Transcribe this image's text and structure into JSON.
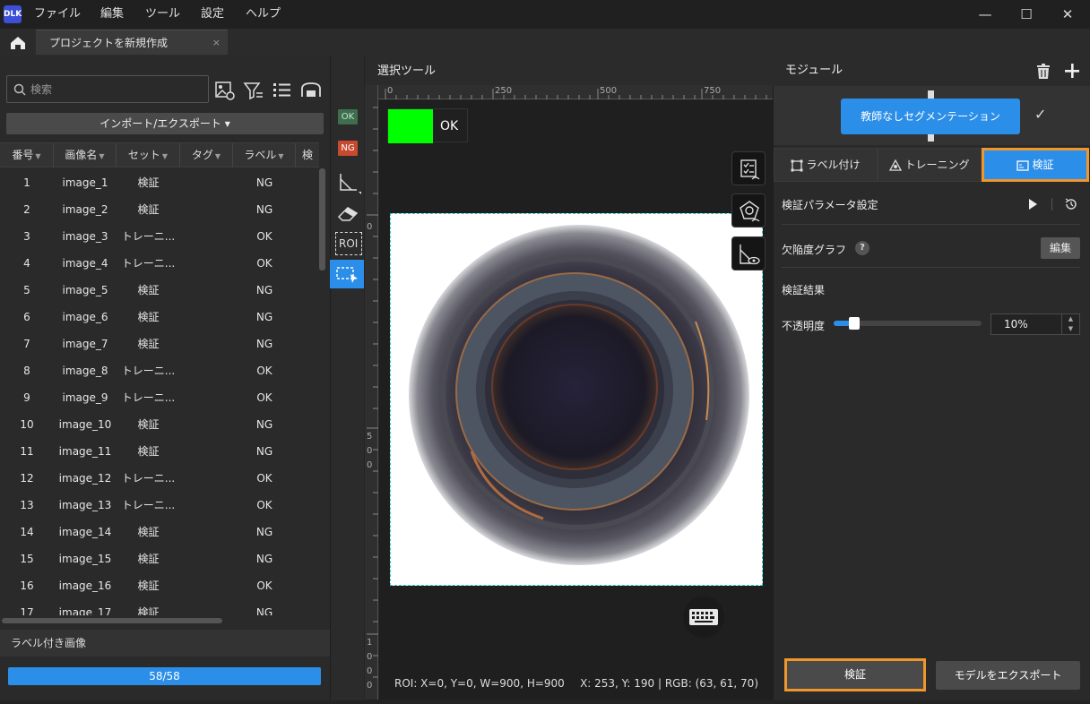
{
  "app": {
    "logo_text": "DLK",
    "menu": [
      "ファイル",
      "編集",
      "ツール",
      "設定",
      "ヘルプ"
    ],
    "window_controls": {
      "minimize": "—",
      "maximize": "☐",
      "close": "✕"
    }
  },
  "tabs": {
    "project_tab": "プロジェクトを新規作成",
    "close_glyph": "×"
  },
  "left": {
    "search_placeholder": "検索",
    "import_export_label": "インポート/エクスポート ▾",
    "table": {
      "headers": [
        "番号",
        "画像名",
        "セット",
        "タグ",
        "ラベル",
        "検"
      ],
      "rows": [
        {
          "no": "1",
          "name": "image_1",
          "set": "検証",
          "tag": "",
          "label": "NG"
        },
        {
          "no": "2",
          "name": "image_2",
          "set": "検証",
          "tag": "",
          "label": "NG"
        },
        {
          "no": "3",
          "name": "image_3",
          "set": "トレーニ...",
          "tag": "",
          "label": "OK"
        },
        {
          "no": "4",
          "name": "image_4",
          "set": "トレーニ...",
          "tag": "",
          "label": "OK"
        },
        {
          "no": "5",
          "name": "image_5",
          "set": "検証",
          "tag": "",
          "label": "NG"
        },
        {
          "no": "6",
          "name": "image_6",
          "set": "検証",
          "tag": "",
          "label": "NG"
        },
        {
          "no": "7",
          "name": "image_7",
          "set": "検証",
          "tag": "",
          "label": "NG"
        },
        {
          "no": "8",
          "name": "image_8",
          "set": "トレーニ...",
          "tag": "",
          "label": "OK"
        },
        {
          "no": "9",
          "name": "image_9",
          "set": "トレーニ...",
          "tag": "",
          "label": "OK"
        },
        {
          "no": "10",
          "name": "image_10",
          "set": "検証",
          "tag": "",
          "label": "NG"
        },
        {
          "no": "11",
          "name": "image_11",
          "set": "検証",
          "tag": "",
          "label": "NG"
        },
        {
          "no": "12",
          "name": "image_12",
          "set": "トレーニ...",
          "tag": "",
          "label": "OK"
        },
        {
          "no": "13",
          "name": "image_13",
          "set": "トレーニ...",
          "tag": "",
          "label": "OK"
        },
        {
          "no": "14",
          "name": "image_14",
          "set": "検証",
          "tag": "",
          "label": "NG"
        },
        {
          "no": "15",
          "name": "image_15",
          "set": "検証",
          "tag": "",
          "label": "NG"
        },
        {
          "no": "16",
          "name": "image_16",
          "set": "検証",
          "tag": "",
          "label": "OK"
        },
        {
          "no": "17",
          "name": "image_17",
          "set": "検証",
          "tag": "",
          "label": "NG"
        }
      ]
    },
    "labeled_images_title": "ラベル付き画像",
    "progress": {
      "text": "58/58",
      "fraction": 1.0
    }
  },
  "toolstrip": {
    "ok_tag": "OK",
    "ng_tag": "NG",
    "roi_label": "ROI"
  },
  "canvas": {
    "title": "選択ツール",
    "ruler_top": [
      "0",
      "250",
      "500",
      "750"
    ],
    "ruler_left": [
      "0",
      "5\n0\n0",
      "1\n0\n0\n0"
    ],
    "result": {
      "text": "OK",
      "color": "#00ff00"
    },
    "roi_status": "ROI: X=0, Y=0, W=900, H=900",
    "cursor_status": "X: 253, Y: 190 | RGB: (63, 61, 70)"
  },
  "right": {
    "module_title": "モジュール",
    "module_node": "教師なしセグメンテーション",
    "module_check": "✓",
    "tabs": [
      {
        "label": "ラベル付け",
        "active": false
      },
      {
        "label": "トレーニング",
        "active": false
      },
      {
        "label": "検証",
        "active": true
      }
    ],
    "params_title": "検証パラメータ設定",
    "defect_graph_label": "欠陥度グラフ",
    "help_glyph": "?",
    "edit_label": "編集",
    "results_title": "検証結果",
    "opacity_label": "不透明度",
    "opacity_value": "10%",
    "opacity_fraction": 0.1,
    "verify_button": "検証",
    "export_button": "モデルをエクスポート"
  },
  "colors": {
    "accent": "#2b8ee8",
    "highlight": "#f0962a",
    "ok_green": "#00ff00",
    "ng_red": "#c74a30"
  }
}
